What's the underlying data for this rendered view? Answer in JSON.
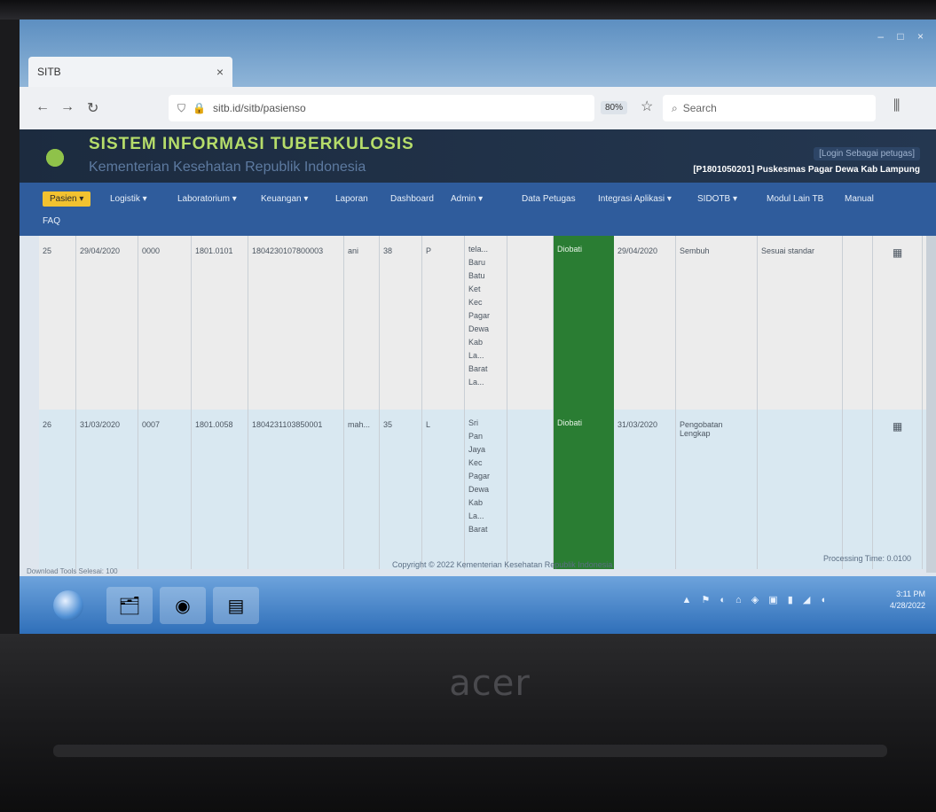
{
  "browser": {
    "tab_title": "SITB",
    "tab_close": "×",
    "url": "sitb.id/sitb/pasienso",
    "zoom": "80%",
    "search_placeholder": "Search"
  },
  "site": {
    "title": "SISTEM INFORMASI TUBERKULOSIS",
    "subtitle": "Kementerian Kesehatan Republik Indonesia",
    "login_info": "[Login Sebagai petugas]",
    "facility": "[P1801050201] Puskesmas Pagar Dewa Kab Lampung"
  },
  "menu": {
    "items": [
      "Pasien",
      "Logistik",
      "Laboratorium",
      "Keuangan",
      "Laporan",
      "Dashboard",
      "Admin",
      "Data Petugas",
      "Integrasi Aplikasi",
      "SIDOTB",
      "Modul Lain TB",
      "Manual"
    ],
    "second_row": "FAQ"
  },
  "table": {
    "rows": [
      {
        "no": "25",
        "date": "29/04/2020",
        "code": "0000",
        "id": "1801.0101",
        "nik": "1804230107800003",
        "name": "ani",
        "age": "38",
        "sex": "P",
        "address": [
          "tela...",
          "Baru",
          "Batu",
          "Ket",
          "Kec",
          "Pagar",
          "Dewa",
          "Kab",
          "La...",
          "Barat",
          "La..."
        ],
        "status": "Diobati",
        "start_date": "29/04/2020",
        "result": "Sembuh",
        "note": "Sesuai standar",
        "action_icon": "▦"
      },
      {
        "no": "26",
        "date": "31/03/2020",
        "code": "0007",
        "id": "1801.0058",
        "nik": "1804231103850001",
        "name": "mah...",
        "age": "35",
        "sex": "L",
        "address": [
          "Sri",
          "Pan",
          "Jaya",
          "Kec",
          "Pagar",
          "Dewa",
          "Kab",
          "La...",
          "Barat"
        ],
        "status": "Diobati",
        "start_date": "31/03/2020",
        "result": "Pengobatan Lengkap",
        "note": "",
        "action_icon": "▦"
      }
    ]
  },
  "footer": {
    "copyright": "Copyright © 2022 Kementerian Kesehatan Republik Indonesia",
    "processing": "Processing Time: 0.0100",
    "status": "Download Tools Selesai: 100"
  },
  "taskbar": {
    "tray_icons": "▲ ⚑ ◐ ⌂ ◈ ▣ ▮ ◢ ◖",
    "time": "3:11 PM",
    "date": "4/28/2022"
  },
  "laptop_brand": "acer"
}
